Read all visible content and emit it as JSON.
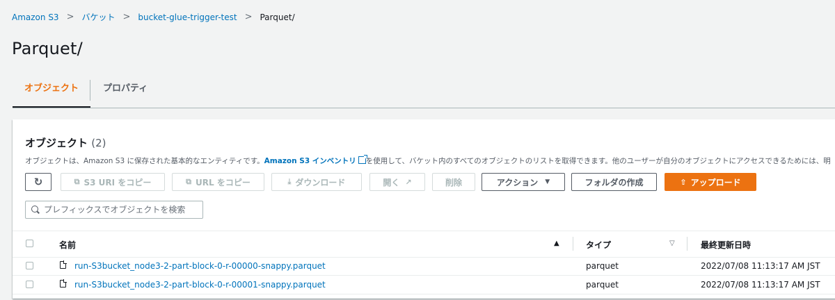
{
  "breadcrumb": {
    "items": [
      "Amazon S3",
      "バケット",
      "bucket-glue-trigger-test"
    ],
    "current": "Parquet/"
  },
  "page_title": "Parquet/",
  "tabs": [
    {
      "label": "オブジェクト",
      "active": true
    },
    {
      "label": "プロパティ",
      "active": false
    }
  ],
  "objects": {
    "title": "オブジェクト",
    "count": "(2)",
    "description_pre": "オブジェクトは、Amazon S3 に保存された基本的なエンティティです。",
    "description_link": "Amazon S3 インベントリ",
    "description_post": "を使用して、バケット内のすべてのオブジェクトのリストを取得できます。他のユーザーが自分のオブジェクトにアクセスできるためには、明",
    "toolbar": {
      "refresh_icon": "↻",
      "copy_s3_uri": "S3 URI をコピー",
      "copy_url": "URL をコピー",
      "download": "ダウンロード",
      "open": "開く",
      "delete": "削除",
      "actions": "アクション",
      "create_folder": "フォルダの作成",
      "upload": "アップロード"
    },
    "search_placeholder": "プレフィックスでオブジェクトを検索",
    "columns": {
      "name": "名前",
      "type": "タイプ",
      "last_modified": "最終更新日時"
    },
    "rows": [
      {
        "name": "run-S3bucket_node3-2-part-block-0-r-00000-snappy.parquet",
        "type": "parquet",
        "modified": "2022/07/08 11:13:17 AM JST"
      },
      {
        "name": "run-S3bucket_node3-2-part-block-0-r-00001-snappy.parquet",
        "type": "parquet",
        "modified": "2022/07/08 11:13:17 AM JST"
      }
    ]
  },
  "colors": {
    "accent": "#ec7211",
    "link": "#0073bb",
    "background": "#f2f3f3"
  }
}
